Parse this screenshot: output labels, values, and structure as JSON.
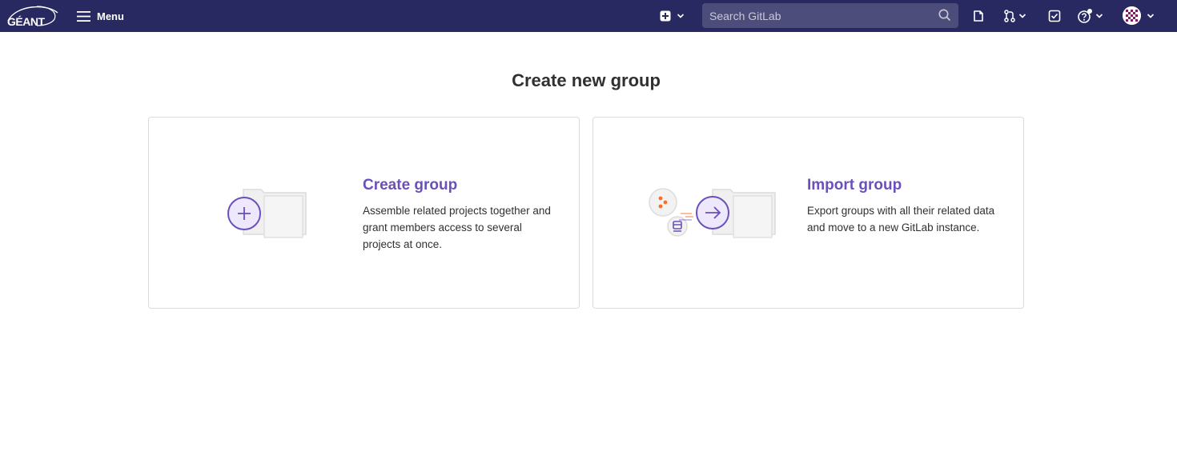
{
  "brand": {
    "logo_text": "GÉANT",
    "accent": "#6b4fbb",
    "navbar_bg": "#292961"
  },
  "navbar": {
    "menu_label": "Menu",
    "menu_icon": "hamburger-icon",
    "create_icon": "plus-square-icon",
    "search_placeholder": "Search GitLab",
    "issues_icon": "issues-icon",
    "merge_requests_icon": "merge-request-icon",
    "todos_icon": "todo-icon",
    "help_icon": "question-icon",
    "avatar_icon": "user-avatar"
  },
  "main": {
    "title": "Create new group",
    "panels": [
      {
        "title": "Create group",
        "description": "Assemble related projects together and grant members access to several projects at once.",
        "icon": "folder-plus-illustration"
      },
      {
        "title": "Import group",
        "description": "Export groups with all their related data and move to a new GitLab instance.",
        "icon": "folder-import-illustration"
      }
    ]
  }
}
